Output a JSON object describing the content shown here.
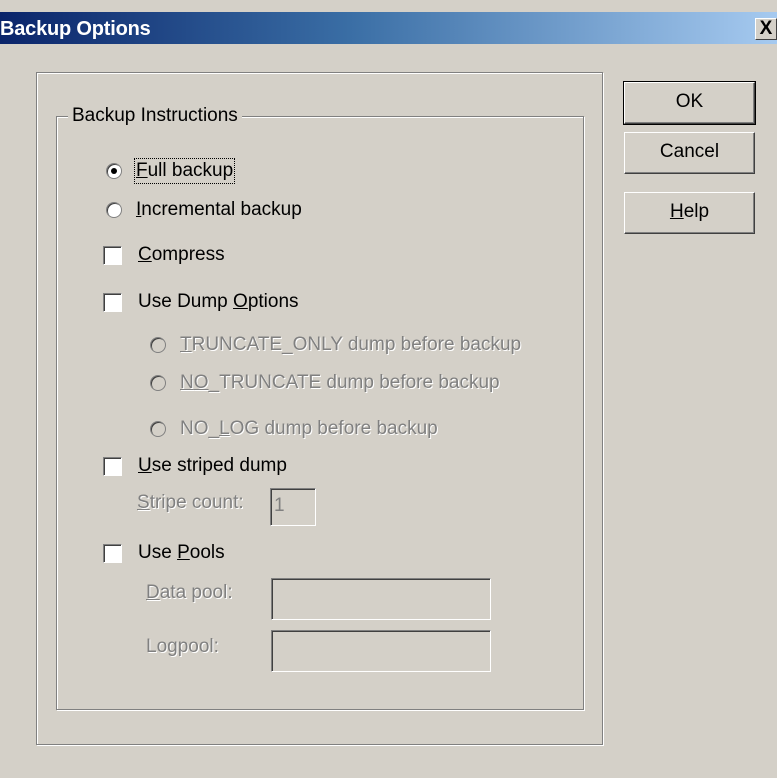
{
  "window": {
    "title": "Backup Options",
    "close_glyph": "X"
  },
  "buttons": {
    "ok": "OK",
    "cancel": "Cancel",
    "help_u": "H",
    "help_rest": "elp"
  },
  "group": {
    "caption": "Backup Instructions"
  },
  "options": {
    "full_backup": {
      "u": "F",
      "rest": "ull backup",
      "checked": true
    },
    "incremental_backup": {
      "u": "I",
      "rest": "ncremental backup",
      "checked": false
    },
    "compress": {
      "u": "C",
      "rest": "ompress",
      "checked": false
    },
    "use_dump_options": {
      "pre": "Use Dump ",
      "u": "O",
      "rest": "ptions",
      "checked": false
    },
    "truncate_only": {
      "u": "T",
      "rest": "RUNCATE_ONLY dump before backup",
      "enabled": false
    },
    "no_truncate": {
      "pre": "N",
      "u": "O",
      "rest": "_TRUNCATE dump before backup",
      "enabled": false
    },
    "no_log": {
      "pre": "NO_",
      "u": "L",
      "rest": "OG dump before backup",
      "enabled": false
    },
    "use_striped_dump": {
      "u": "U",
      "rest": "se striped dump",
      "checked": false
    },
    "stripe_count": {
      "u": "S",
      "rest": "tripe count:",
      "value": "1"
    },
    "use_pools": {
      "pre": "Use ",
      "u": "P",
      "rest": "ools",
      "checked": false
    },
    "data_pool": {
      "u": "D",
      "rest": "ata pool:",
      "value": ""
    },
    "log_pool": {
      "pre": "Lo",
      "u": "g",
      "rest": " pool:",
      "value": ""
    }
  },
  "icons": {
    "close": "close-icon"
  }
}
